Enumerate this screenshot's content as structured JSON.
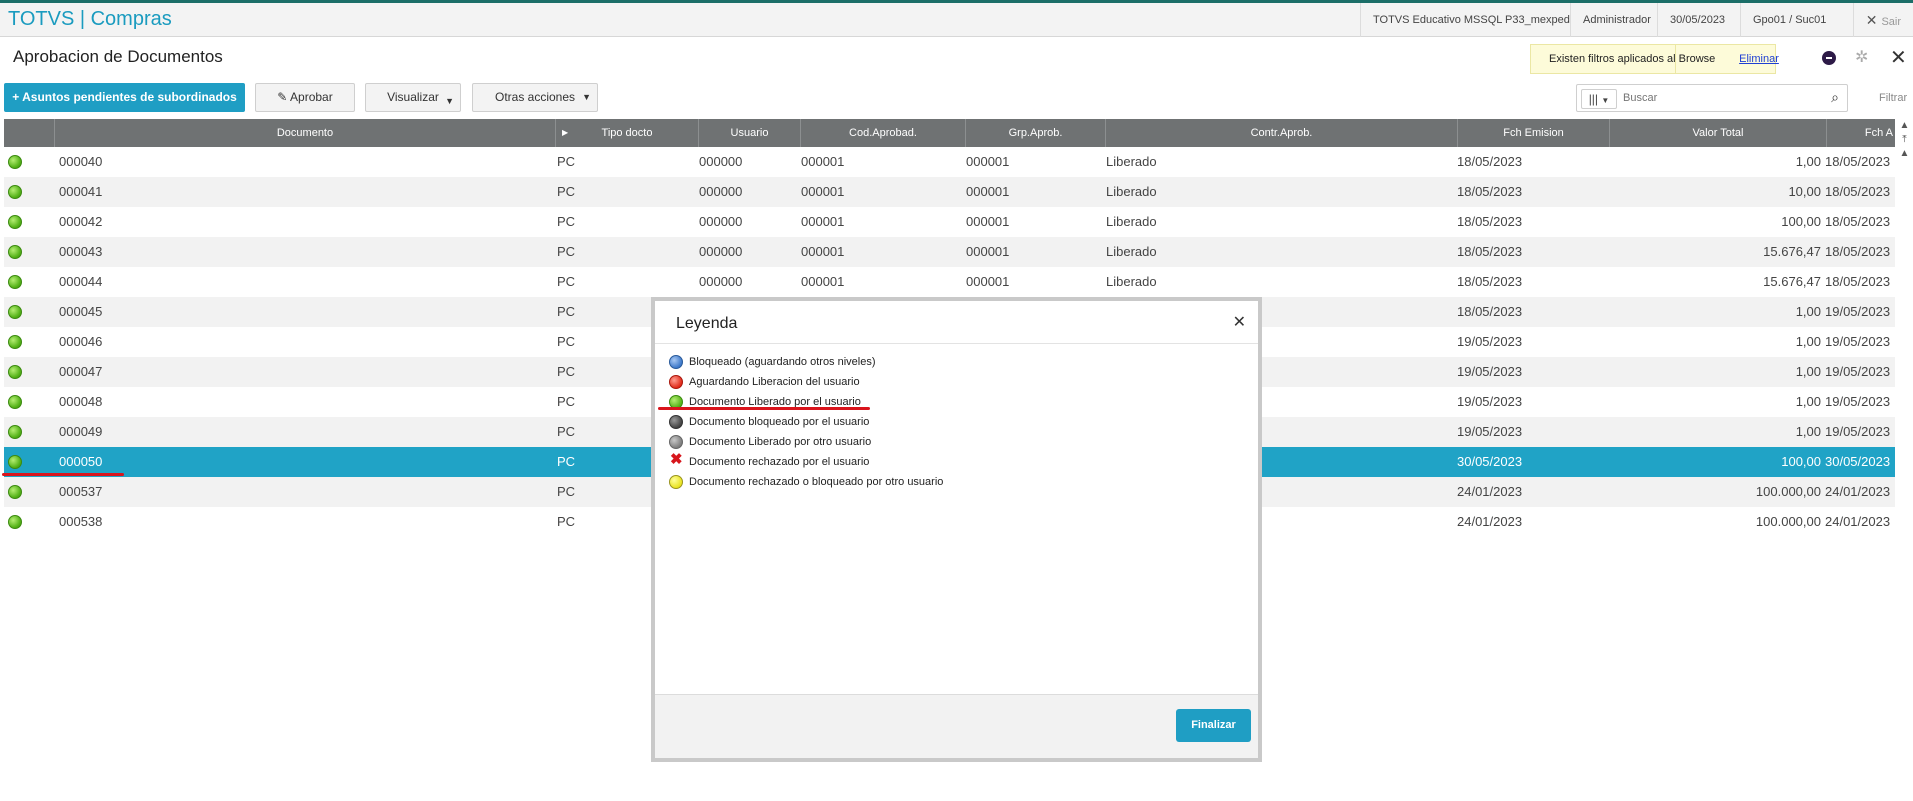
{
  "app": {
    "title": "TOTVS | Compras"
  },
  "topbar": {
    "environment": "TOTVS Educativo MSSQL P33_mexped",
    "user": "Administrador",
    "date": "30/05/2023",
    "branch": "Gpo01 / Suc01",
    "exit_label": "Sair"
  },
  "page": {
    "title": "Aprobacion de Documentos"
  },
  "notice": {
    "message": "Existen filtros aplicados al Browse",
    "remove_link": "Eliminar"
  },
  "toolbar": {
    "pending_label": "Asuntos pendientes de subordinados",
    "approve_label": "Aprobar",
    "view_label": "Visualizar",
    "other_label": "Otras acciones"
  },
  "search": {
    "placeholder": "Buscar",
    "value": "Buscar",
    "filter_label": "Filtrar"
  },
  "grid": {
    "columns": [
      "Documento",
      "Tipo docto",
      "Usuario",
      "Cod.Aprobad.",
      "Grp.Aprob.",
      "Contr.Aprob.",
      "Fch Emision",
      "Valor Total",
      "Fch A"
    ],
    "rows": [
      {
        "doc": "000040",
        "tipo": "PC",
        "usuario": "000000",
        "cod": "000001",
        "grp": "000001",
        "contr": "Liberado",
        "fch": "18/05/2023",
        "valor": "1,00",
        "fch2": "18/05/2023"
      },
      {
        "doc": "000041",
        "tipo": "PC",
        "usuario": "000000",
        "cod": "000001",
        "grp": "000001",
        "contr": "Liberado",
        "fch": "18/05/2023",
        "valor": "10,00",
        "fch2": "18/05/2023"
      },
      {
        "doc": "000042",
        "tipo": "PC",
        "usuario": "000000",
        "cod": "000001",
        "grp": "000001",
        "contr": "Liberado",
        "fch": "18/05/2023",
        "valor": "100,00",
        "fch2": "18/05/2023"
      },
      {
        "doc": "000043",
        "tipo": "PC",
        "usuario": "000000",
        "cod": "000001",
        "grp": "000001",
        "contr": "Liberado",
        "fch": "18/05/2023",
        "valor": "15.676,47",
        "fch2": "18/05/2023"
      },
      {
        "doc": "000044",
        "tipo": "PC",
        "usuario": "000000",
        "cod": "000001",
        "grp": "000001",
        "contr": "Liberado",
        "fch": "18/05/2023",
        "valor": "15.676,47",
        "fch2": "18/05/2023"
      },
      {
        "doc": "000045",
        "tipo": "PC",
        "usuario": "",
        "cod": "",
        "grp": "",
        "contr": "",
        "fch": "18/05/2023",
        "valor": "1,00",
        "fch2": "19/05/2023"
      },
      {
        "doc": "000046",
        "tipo": "PC",
        "usuario": "",
        "cod": "",
        "grp": "",
        "contr": "",
        "fch": "19/05/2023",
        "valor": "1,00",
        "fch2": "19/05/2023"
      },
      {
        "doc": "000047",
        "tipo": "PC",
        "usuario": "",
        "cod": "",
        "grp": "",
        "contr": "",
        "fch": "19/05/2023",
        "valor": "1,00",
        "fch2": "19/05/2023"
      },
      {
        "doc": "000048",
        "tipo": "PC",
        "usuario": "",
        "cod": "",
        "grp": "",
        "contr": "",
        "fch": "19/05/2023",
        "valor": "1,00",
        "fch2": "19/05/2023"
      },
      {
        "doc": "000049",
        "tipo": "PC",
        "usuario": "",
        "cod": "",
        "grp": "",
        "contr": "",
        "fch": "19/05/2023",
        "valor": "1,00",
        "fch2": "19/05/2023"
      },
      {
        "doc": "000050",
        "tipo": "PC",
        "usuario": "",
        "cod": "",
        "grp": "",
        "contr": "",
        "fch": "30/05/2023",
        "valor": "100,00",
        "fch2": "30/05/2023"
      },
      {
        "doc": "000537",
        "tipo": "PC",
        "usuario": "",
        "cod": "",
        "grp": "",
        "contr": "",
        "fch": "24/01/2023",
        "valor": "100.000,00",
        "fch2": "24/01/2023"
      },
      {
        "doc": "000538",
        "tipo": "PC",
        "usuario": "",
        "cod": "",
        "grp": "",
        "contr": "",
        "fch": "24/01/2023",
        "valor": "100.000,00",
        "fch2": "24/01/2023"
      }
    ]
  },
  "legend": {
    "title": "Leyenda",
    "items": [
      {
        "label": "Bloqueado (aguardando otros niveles)",
        "icon": "blue-dot-icon"
      },
      {
        "label": "Aguardando Liberacion del usuario",
        "icon": "red-dot-icon"
      },
      {
        "label": "Documento Liberado por el usuario",
        "icon": "green-dot-icon"
      },
      {
        "label": "Documento bloqueado por el usuario",
        "icon": "dark-gray-dot-icon"
      },
      {
        "label": "Documento Liberado por otro usuario",
        "icon": "gray-dot-icon"
      },
      {
        "label": "Documento rechazado por el usuario",
        "icon": "red-x-icon"
      },
      {
        "label": "Documento rechazado o bloqueado por otro usuario",
        "icon": "yellow-dot-icon"
      }
    ],
    "finish_label": "Finalizar"
  },
  "colors": {
    "accent": "#1f9ec4",
    "selected_row": "#20a3c6",
    "header": "#6f7273",
    "highlight": "#d9141c"
  }
}
